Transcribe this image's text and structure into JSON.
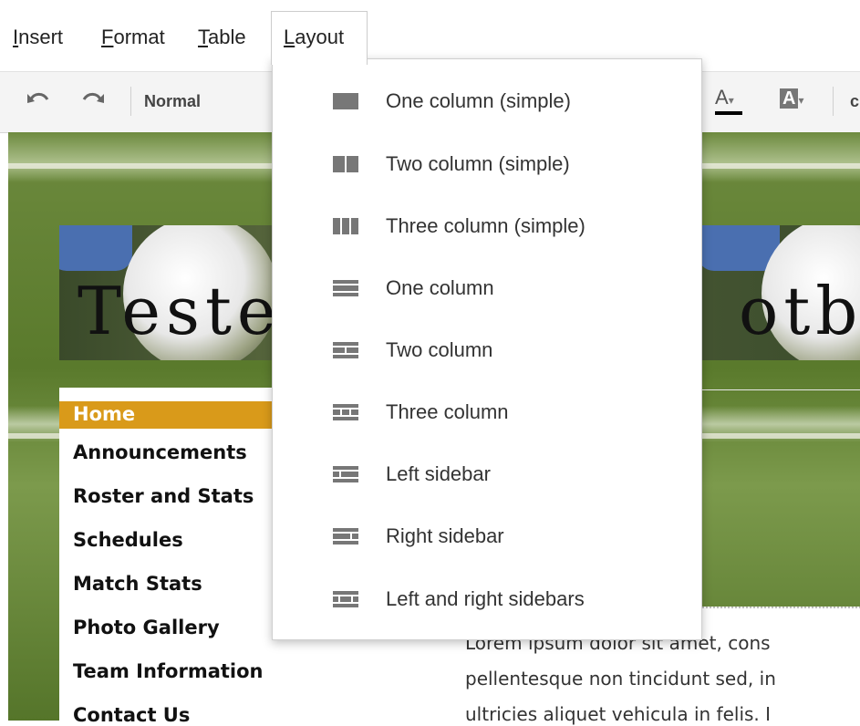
{
  "menubar": {
    "insert": "Insert",
    "format": "Format",
    "table": "Table",
    "layout": "Layout"
  },
  "toolbar": {
    "undo_icon": "undo-icon",
    "redo_icon": "redo-icon",
    "style_label": "Normal",
    "text_color_label": "A",
    "highlight_label": "A",
    "partial_label": "c"
  },
  "layout_menu": {
    "items": [
      {
        "label": "One column (simple)",
        "icon": "one-column-simple-icon"
      },
      {
        "label": "Two column (simple)",
        "icon": "two-column-simple-icon"
      },
      {
        "label": "Three column (simple)",
        "icon": "three-column-simple-icon"
      },
      {
        "label": "One column",
        "icon": "one-column-icon"
      },
      {
        "label": "Two column",
        "icon": "two-column-icon"
      },
      {
        "label": "Three column",
        "icon": "three-column-icon"
      },
      {
        "label": "Left sidebar",
        "icon": "left-sidebar-icon"
      },
      {
        "label": "Right sidebar",
        "icon": "right-sidebar-icon"
      },
      {
        "label": "Left and right sidebars",
        "icon": "left-right-sidebars-icon"
      }
    ]
  },
  "banner": {
    "title_left": "Tester",
    "title_right": "otball"
  },
  "nav": {
    "items": [
      "Home",
      "Announcements",
      "Roster and Stats",
      "Schedules",
      "Match Stats",
      "Photo Gallery",
      "Team Information",
      "Contact Us"
    ]
  },
  "content": {
    "lines": [
      "Lorem ipsum dolor sit amet, cons",
      "pellentesque non tincidunt sed, in",
      "ultricies aliquet vehicula in felis. I"
    ]
  },
  "colors": {
    "nav_active": "#d99a1a",
    "menu_text": "#333333",
    "grass": "#5a7a2c"
  }
}
